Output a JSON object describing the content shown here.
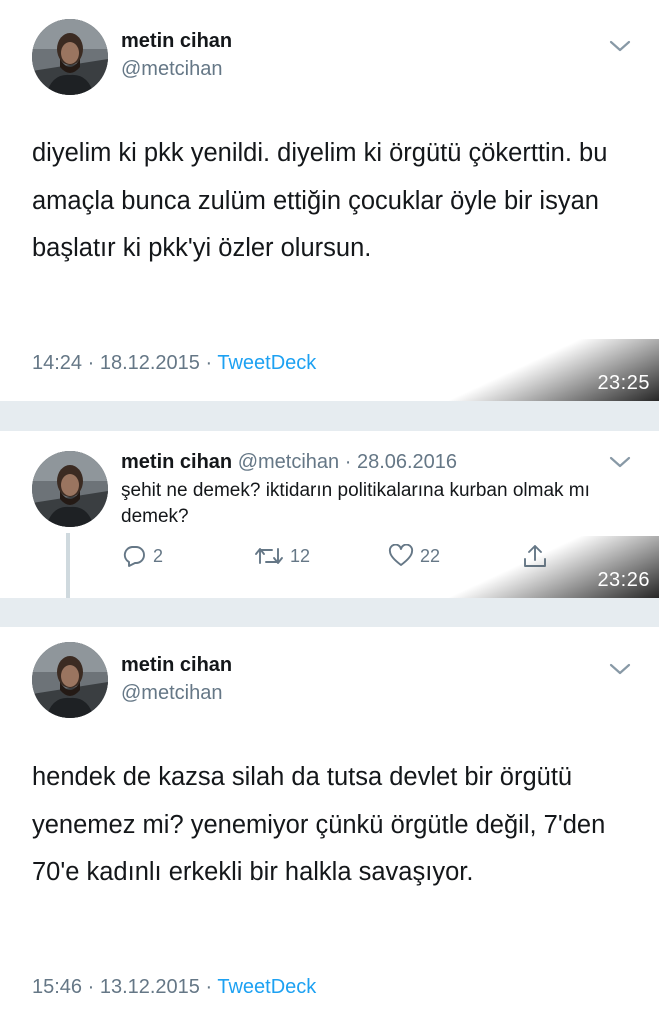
{
  "tweets": [
    {
      "name": "metin cihan",
      "handle": "@metcihan",
      "text": "diyelim ki pkk yenildi. diyelim ki örgütü çökerttin. bu amaçla bunca zulüm ettiğin çocuklar öyle bir isyan başlatır ki pkk'yi özler olursun.",
      "meta_time": "14:24 · 18.12.2015 · ",
      "source": "TweetDeck",
      "screenshot_time": "23:25"
    },
    {
      "name": "metin cihan",
      "handle": "@metcihan",
      "date": "· 28.06.2016",
      "text": "şehit ne demek? iktidarın politikalarına kurban olmak mı demek?",
      "reply_count": "2",
      "retweet_count": "12",
      "like_count": "22",
      "screenshot_time": "23:26"
    },
    {
      "name": "metin cihan",
      "handle": "@metcihan",
      "text": "hendek de kazsa silah da tutsa devlet bir örgütü yenemez mi? yenemiyor çünkü örgütle değil, 7'den 70'e kadınlı erkekli bir halkla savaşıyor.",
      "meta_time": "15:46 · 13.12.2015 · ",
      "source": "TweetDeck"
    }
  ],
  "icons": {
    "chevron": "chevron-down-icon",
    "reply": "reply-icon",
    "retweet": "retweet-icon",
    "like": "heart-icon",
    "share": "share-icon",
    "avatar": "avatar"
  },
  "colors": {
    "background": "#e6ecf0",
    "link": "#1da1f2",
    "secondary": "#657786",
    "text": "#14171a"
  }
}
